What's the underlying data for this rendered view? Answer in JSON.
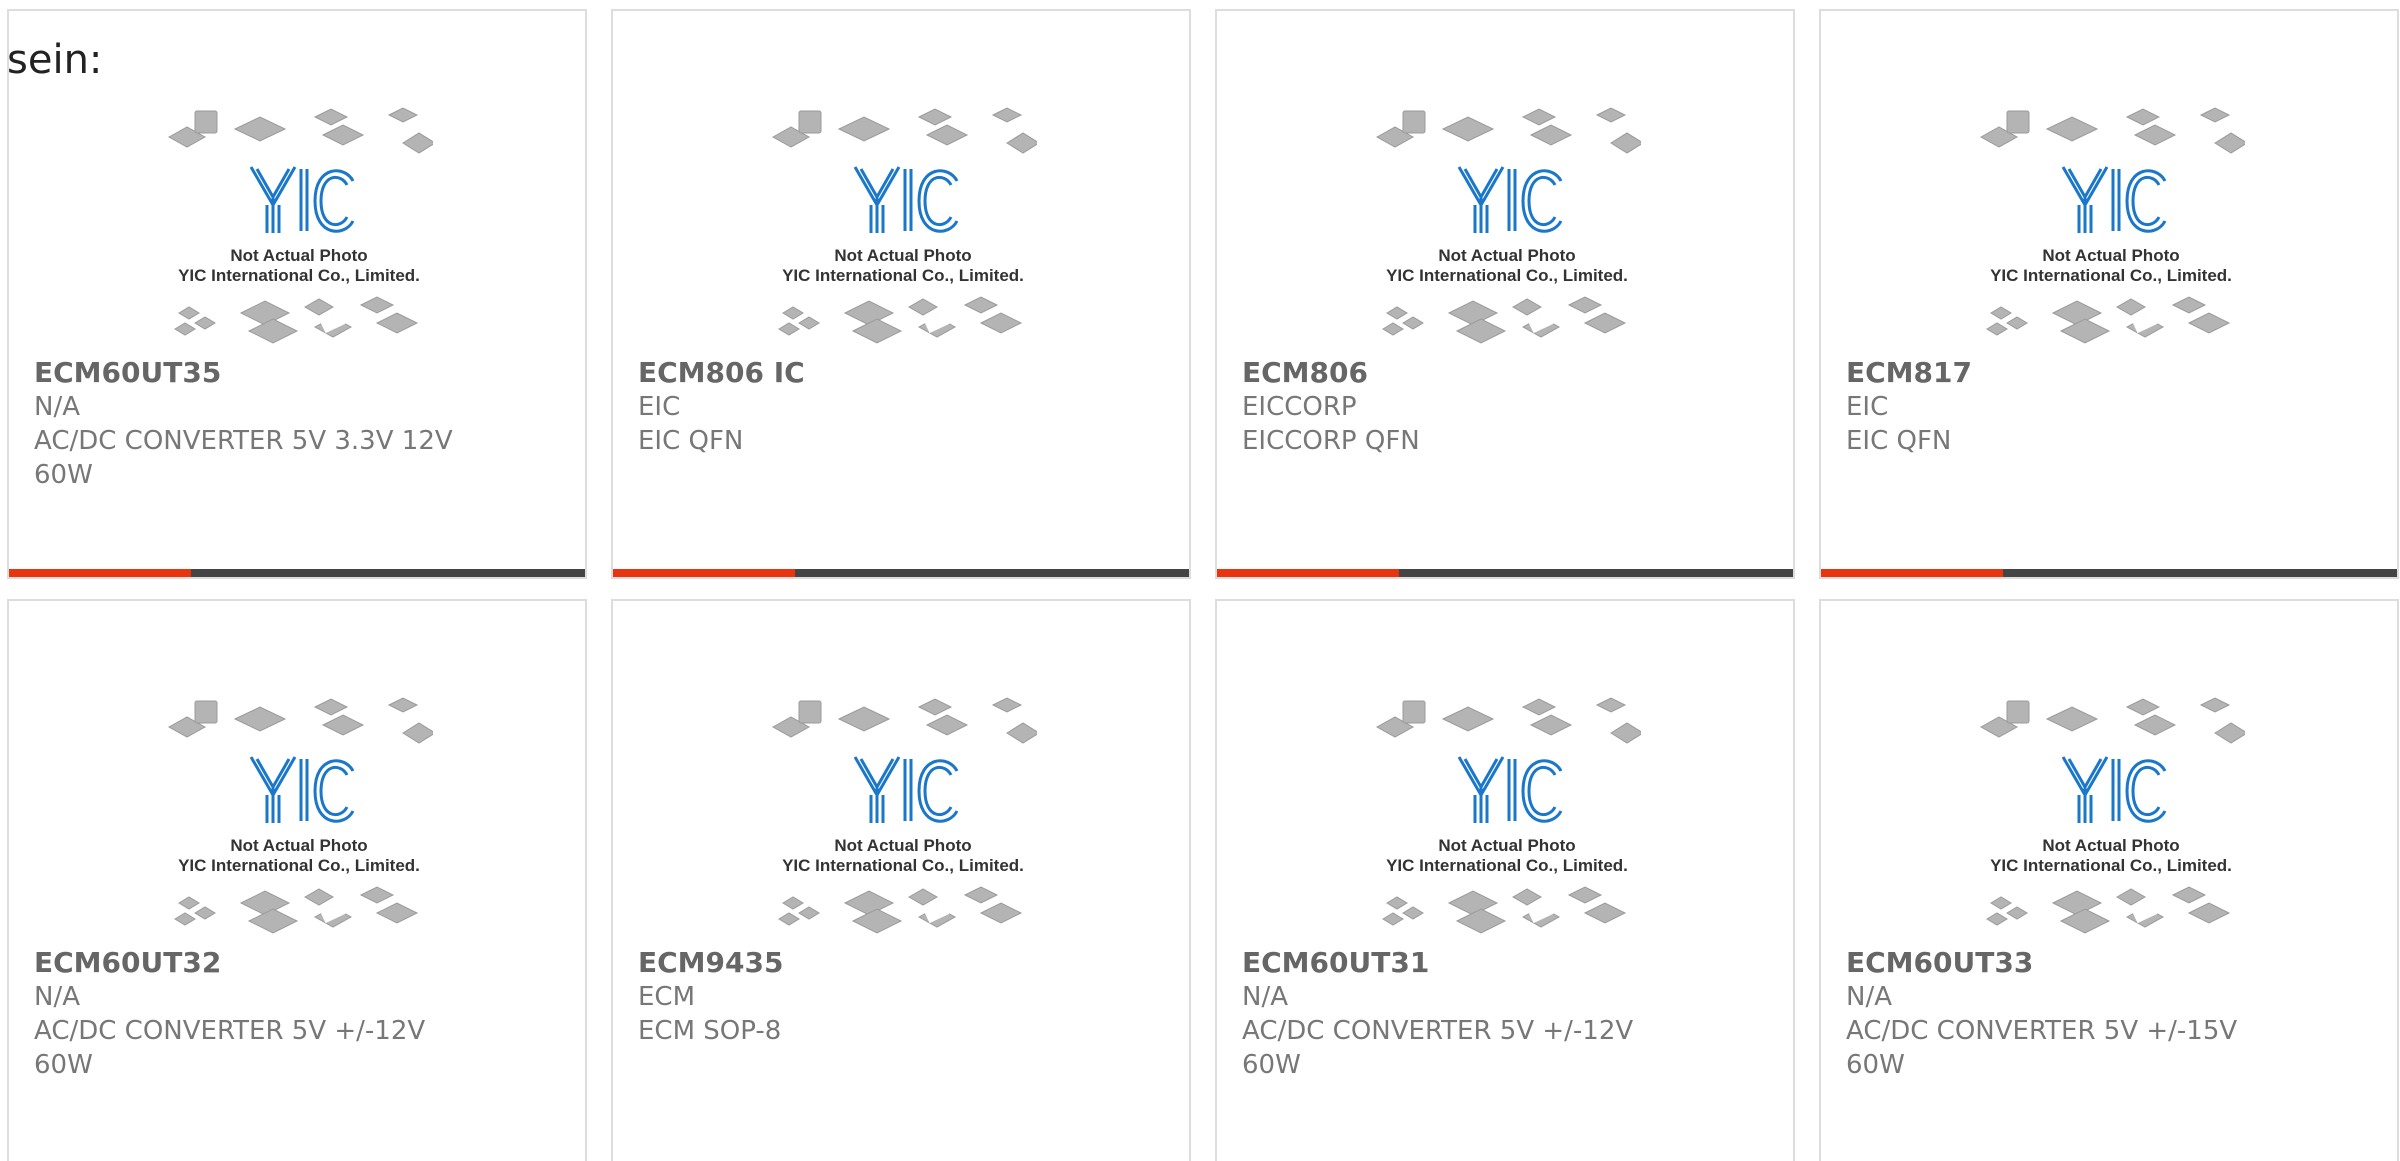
{
  "intro_text": "sein:",
  "photo": {
    "brand": "YIC",
    "caption_1": "Not Actual Photo",
    "caption_2": "YIC International Co., Limited."
  },
  "colors": {
    "accent": "#e8350f",
    "bar": "#444444",
    "logo": "#1a77c9"
  },
  "products": [
    {
      "part": "ECM60UT35",
      "manufacturer": "N/A",
      "description": "AC/DC CONVERTER 5V 3.3V 12V",
      "extra": "60W"
    },
    {
      "part": "ECM806 IC",
      "manufacturer": "EIC",
      "description": "EIC QFN",
      "extra": ""
    },
    {
      "part": "ECM806",
      "manufacturer": "EICCORP",
      "description": "EICCORP QFN",
      "extra": ""
    },
    {
      "part": "ECM817",
      "manufacturer": "EIC",
      "description": "EIC QFN",
      "extra": ""
    },
    {
      "part": "ECM60UT32",
      "manufacturer": "N/A",
      "description": "AC/DC CONVERTER 5V +/-12V",
      "extra": "60W"
    },
    {
      "part": "ECM9435",
      "manufacturer": "ECM",
      "description": "ECM SOP-8",
      "extra": ""
    },
    {
      "part": "ECM60UT31",
      "manufacturer": "N/A",
      "description": "AC/DC CONVERTER 5V +/-12V",
      "extra": "60W"
    },
    {
      "part": "ECM60UT33",
      "manufacturer": "N/A",
      "description": "AC/DC CONVERTER 5V +/-15V",
      "extra": "60W"
    }
  ]
}
